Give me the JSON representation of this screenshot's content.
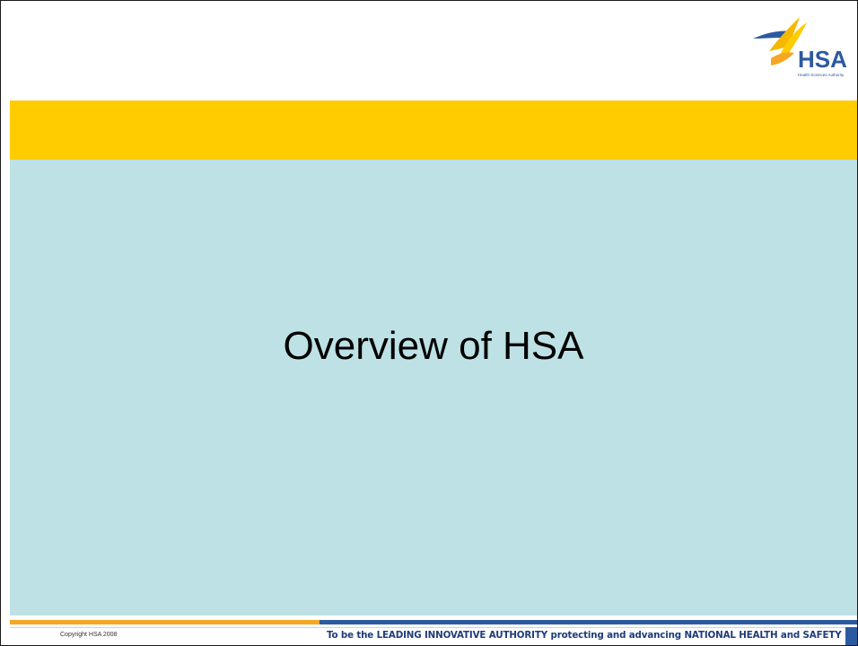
{
  "header": {
    "logo_icon": "hsa-logo-icon",
    "logo_text": "HSA",
    "logo_subtext": "Health Sciences Authority"
  },
  "main": {
    "title": "Overview of HSA"
  },
  "footer": {
    "copyright": "Copyright HSA 2008",
    "tagline": "To be the LEADING INNOVATIVE AUTHORITY protecting and advancing NATIONAL HEALTH and SAFETY"
  },
  "colors": {
    "accent_yellow": "#ffcc00",
    "panel_teal": "#bde1e4",
    "footer_orange": "#f5a623",
    "footer_blue": "#2c5aa0",
    "tagline_navy": "#1f3b7a"
  }
}
